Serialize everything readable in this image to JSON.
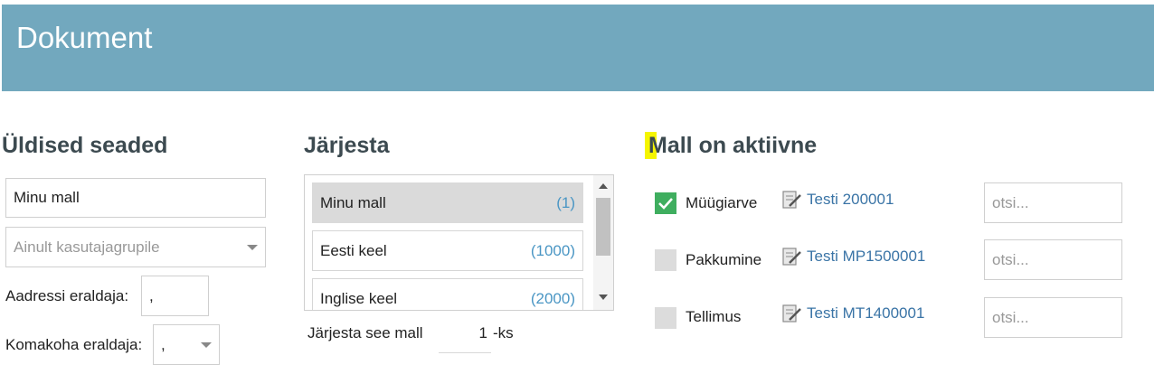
{
  "header": {
    "title": "Dokument"
  },
  "general": {
    "title": "Üldised seaded",
    "name_value": "Minu mall",
    "group_placeholder": "Ainult kasutajagrupile",
    "address_sep_label": "Aadressi eraldaja:",
    "address_sep_value": ",",
    "decimal_sep_label": "Komakoha eraldaja:",
    "decimal_sep_value": ","
  },
  "order": {
    "title": "Järjesta",
    "items": [
      {
        "label": "Minu mall",
        "count": "(1)",
        "selected": true
      },
      {
        "label": "Eesti keel",
        "count": "(1000)",
        "selected": false
      },
      {
        "label": "Inglise keel",
        "count": "(2000)",
        "selected": false
      }
    ],
    "order_label": "Järjesta see mall",
    "order_value": "1",
    "order_suffix": "-ks"
  },
  "active": {
    "title": "Mall on aktiivne",
    "rows": [
      {
        "label": "Müügiarve",
        "checked": true,
        "link": "Testi 200001",
        "search_placeholder": "otsi..."
      },
      {
        "label": "Pakkumine",
        "checked": false,
        "link": "Testi MP1500001",
        "search_placeholder": "otsi..."
      },
      {
        "label": "Tellimus",
        "checked": false,
        "link": "Testi MT1400001",
        "search_placeholder": "otsi..."
      }
    ]
  },
  "colors": {
    "header_bg": "#72a8be",
    "check_green": "#3fae5f",
    "link_blue": "#3a74a6",
    "count_blue": "#4a96c4",
    "highlight_yellow": "#f5f500"
  }
}
